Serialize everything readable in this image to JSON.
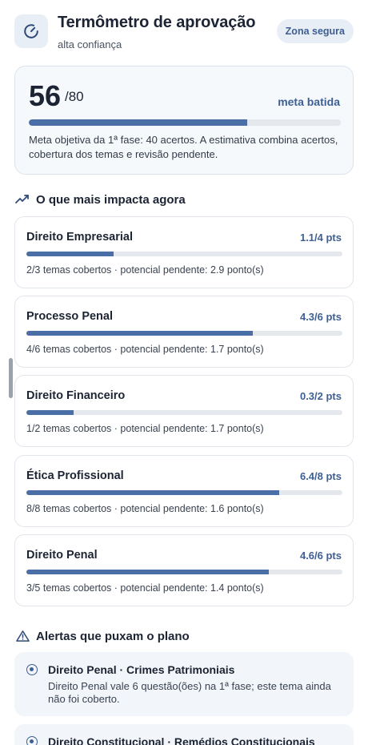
{
  "header": {
    "title": "Termômetro de aprovação",
    "subtitle": "alta confiança",
    "badge": "Zona segura",
    "icon": "gauge-icon"
  },
  "score": {
    "value": "56",
    "total": "/80",
    "status": "meta batida",
    "progress_fraction": 0.7,
    "description": "Meta objetiva da 1ª fase: 40 acertos. A estimativa combina acertos, cobertura dos temas e revisão pendente."
  },
  "impact": {
    "title": "O que mais impacta agora",
    "icon": "trending-up-icon",
    "items": [
      {
        "name": "Direito Empresarial",
        "points": "1.1/4 pts",
        "fraction": 0.275,
        "info": "2/3 temas cobertos · potencial pendente: 2.9 ponto(s)"
      },
      {
        "name": "Processo Penal",
        "points": "4.3/6 pts",
        "fraction": 0.7167,
        "info": "4/6 temas cobertos · potencial pendente: 1.7 ponto(s)"
      },
      {
        "name": "Direito Financeiro",
        "points": "0.3/2 pts",
        "fraction": 0.15,
        "info": "1/2 temas cobertos · potencial pendente: 1.7 ponto(s)"
      },
      {
        "name": "Ética Profissional",
        "points": "6.4/8 pts",
        "fraction": 0.8,
        "info": "8/8 temas cobertos · potencial pendente: 1.6 ponto(s)"
      },
      {
        "name": "Direito Penal",
        "points": "4.6/6 pts",
        "fraction": 0.7667,
        "info": "3/5 temas cobertos · potencial pendente: 1.4 ponto(s)"
      }
    ]
  },
  "alerts": {
    "title": "Alertas que puxam o plano",
    "icon": "warning-triangle-icon",
    "items": [
      {
        "title": "Direito Penal · Crimes Patrimoniais",
        "body": "Direito Penal vale 6 questão(ões) na 1ª fase; este tema ainda não foi coberto."
      },
      {
        "title": "Direito Constitucional · Remédios Constitucionais",
        "body": ""
      }
    ]
  },
  "colors": {
    "accent": "#3e5f94",
    "bar_fill": "#4a6ea6",
    "track": "#e4e7ec",
    "card_tint": "#f6f9fc"
  }
}
